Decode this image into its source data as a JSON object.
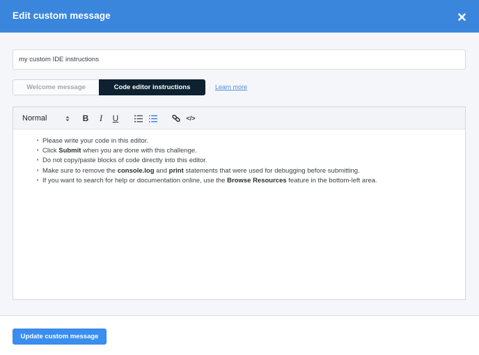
{
  "header": {
    "title": "Edit custom message",
    "close_icon": "close-icon"
  },
  "name_input": {
    "value": "my custom IDE instructions"
  },
  "tabs": [
    {
      "label": "Welcome message",
      "active": false
    },
    {
      "label": "Code editor instructions",
      "active": true
    }
  ],
  "learn_more": "Learn more",
  "toolbar": {
    "format_select": "Normal",
    "bold": "B",
    "italic": "I",
    "underline": "U",
    "code": "</>",
    "icons": [
      "bold-icon",
      "italic-icon",
      "underline-icon",
      "ordered-list-icon",
      "bullet-list-icon",
      "link-icon",
      "code-icon"
    ],
    "active_color": "#2d6fe0"
  },
  "editor_content": {
    "items": [
      {
        "pre": "Please write your code in this editor.",
        "b1": "",
        "mid": "",
        "b2": "",
        "post": ""
      },
      {
        "pre": "Click ",
        "b1": "Submit",
        "mid": " when you are done with this challenge.",
        "b2": "",
        "post": ""
      },
      {
        "pre": "Do not copy/paste blocks of code directly into this editor.",
        "b1": "",
        "mid": "",
        "b2": "",
        "post": ""
      },
      {
        "pre": "Make sure to remove the ",
        "b1": "console.log",
        "mid": " and ",
        "b2": "print",
        "post": " statements that were used for debugging before submitting."
      },
      {
        "pre": "If you want to search for help or documentation online, use the ",
        "b1": "Browse Resources",
        "mid": " feature in the bottom-left area.",
        "b2": "",
        "post": ""
      }
    ]
  },
  "footer": {
    "update_button": "Update custom message"
  },
  "colors": {
    "header": "#3a86dd",
    "active_tab": "#0d2130",
    "primary_button": "#3a8ef0",
    "link": "#4a90e2"
  }
}
